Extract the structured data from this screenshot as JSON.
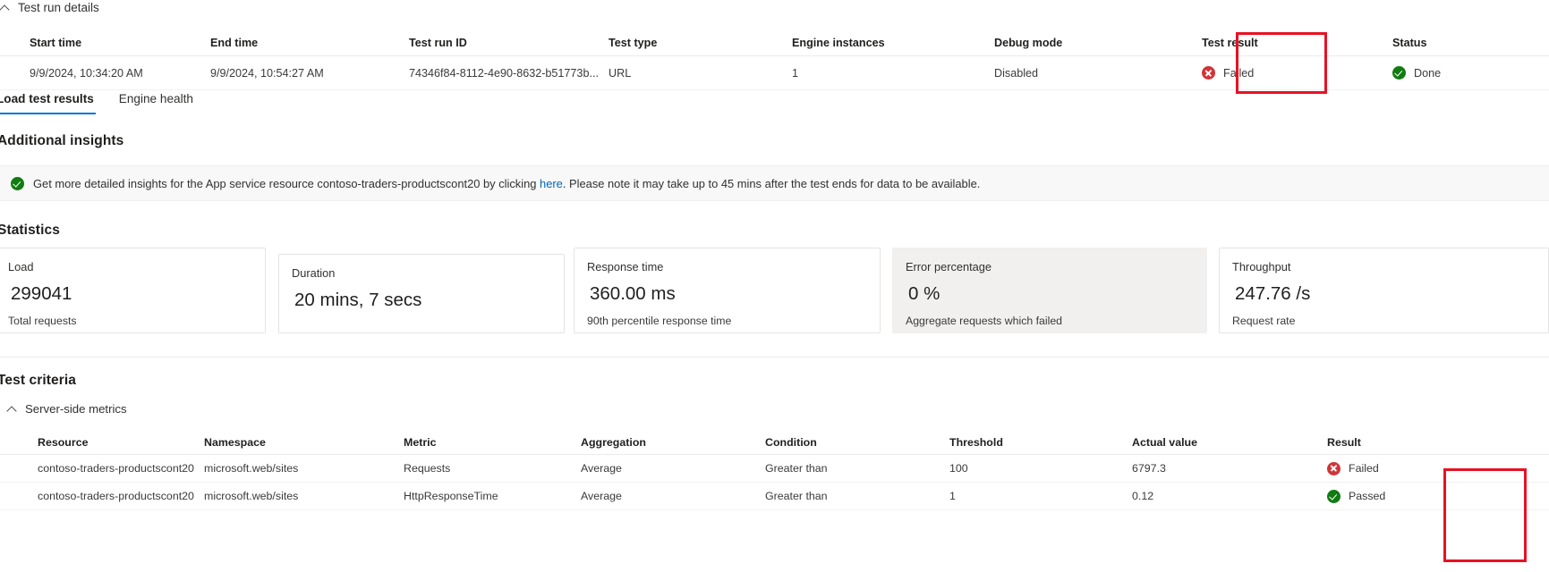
{
  "test_run_details": {
    "section_label": "Test run details",
    "collapse_icon": "chevron-up-icon",
    "columns": [
      "Start time",
      "End time",
      "Test run ID",
      "Test type",
      "Engine instances",
      "Debug mode",
      "Test result",
      "Status"
    ],
    "row": {
      "start_time": "9/9/2024, 10:34:20 AM",
      "end_time": "9/9/2024, 10:54:27 AM",
      "test_run_id": "74346f84-8112-4e90-8632-b51773b...",
      "test_type": "URL",
      "engine_instances": "1",
      "debug_mode": "Disabled",
      "test_result": "Failed",
      "test_result_icon": "error-circle-icon",
      "status": "Done",
      "status_icon": "success-circle-icon"
    }
  },
  "tabs": [
    {
      "label": "Load test results",
      "active": true
    },
    {
      "label": "Engine health",
      "active": false
    }
  ],
  "additional_insights": {
    "title": "Additional insights",
    "icon": "success-circle-icon",
    "text_before_link": "Get more detailed insights for the App service resource contoso-traders-productscont20 by clicking ",
    "link_text": "here",
    "text_after_link": ". Please note it may take up to 45 mins after the test ends for data to be available."
  },
  "statistics": {
    "title": "Statistics",
    "cards": [
      {
        "label": "Load",
        "value": "299041",
        "caption": "Total requests",
        "hovered": false
      },
      {
        "label": "Duration",
        "value": "20 mins, 7 secs",
        "caption": "",
        "hovered": false
      },
      {
        "label": "Response time",
        "value": "360.00 ms",
        "caption": "90th percentile response time",
        "hovered": false
      },
      {
        "label": "Error percentage",
        "value": "0 %",
        "caption": "Aggregate requests which failed",
        "hovered": true
      },
      {
        "label": "Throughput",
        "value": "247.76 /s",
        "caption": "Request rate",
        "hovered": false
      }
    ]
  },
  "test_criteria": {
    "title": "Test criteria",
    "subsection_label": "Server-side metrics",
    "collapse_icon": "chevron-up-icon",
    "columns": [
      "Resource",
      "Namespace",
      "Metric",
      "Aggregation",
      "Condition",
      "Threshold",
      "Actual value",
      "Result"
    ],
    "rows": [
      {
        "resource": "contoso-traders-productscont20",
        "namespace": "microsoft.web/sites",
        "metric": "Requests",
        "aggregation": "Average",
        "condition": "Greater than",
        "threshold": "100",
        "actual_value": "6797.3",
        "result": "Failed",
        "result_icon": "error-circle-icon"
      },
      {
        "resource": "contoso-traders-productscont20",
        "namespace": "microsoft.web/sites",
        "metric": "HttpResponseTime",
        "aggregation": "Average",
        "condition": "Greater than",
        "threshold": "1",
        "actual_value": "0.12",
        "result": "Passed",
        "result_icon": "success-circle-icon"
      }
    ]
  },
  "annotations": {
    "test_result_highlight": "red-rectangle-highlight",
    "criteria_result_highlight": "red-rectangle-highlight",
    "color": "#e81123"
  }
}
